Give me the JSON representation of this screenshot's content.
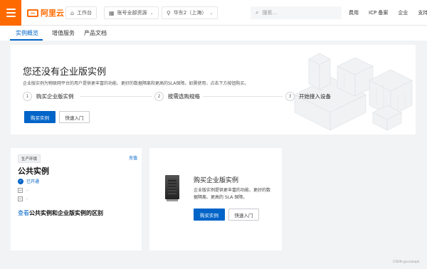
{
  "header": {
    "logo_text": "阿里云",
    "workbench": "工作台",
    "resource_group": "账号全部资源",
    "region": "华东2（上海）",
    "search_placeholder": "搜索...",
    "links": [
      "费用",
      "ICP 备案",
      "企业",
      "支持"
    ],
    "accent_color": "#ff6a00"
  },
  "tabs": [
    {
      "label": "实例概览",
      "active": true
    },
    {
      "label": "增值服务",
      "active": false
    },
    {
      "label": "产品文档",
      "active": false
    }
  ],
  "hero": {
    "title": "您还没有企业版实例",
    "description": "企业版实例为物联网平台的用户提供更丰富的功能、更好的数据隔离和更高的SLA保障。如需使用，点击下方按钮购买。",
    "steps": [
      {
        "num": "1",
        "label": "购买企业版实例"
      },
      {
        "num": "2",
        "label": "按需选购规格"
      },
      {
        "num": "3",
        "label": "开始接入设备"
      }
    ],
    "buy_button": "购买实例",
    "quickstart_button": "快速入门"
  },
  "public_card": {
    "env_tag": "生产环境",
    "recharge_link": "充值",
    "title": "公共实例",
    "status": "已开通",
    "field1": "-",
    "field2": "-",
    "link_prefix": "查看",
    "link_rest": "公共实例和企业版实例的区别"
  },
  "enterprise_card": {
    "title": "购买企业版实例",
    "description": "企业版实例提供更丰富的功能、更好的数据隔离、更高的 SLA 保障。",
    "buy_button": "购买实例",
    "quickstart_button": "快速入门"
  },
  "watermark": "CSDN @cookapk",
  "colors": {
    "primary": "#0064c8",
    "brand": "#ff6a00"
  }
}
